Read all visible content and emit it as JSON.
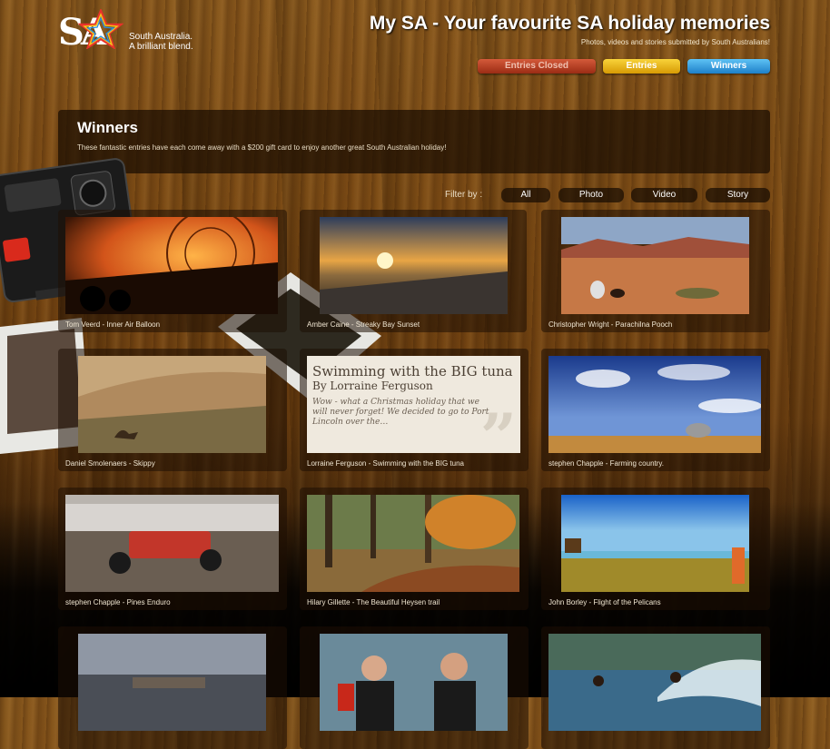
{
  "brand": {
    "logo_letters": "SA",
    "line1": "South Australia.",
    "line2": "A brilliant blend."
  },
  "header": {
    "title": "My SA - Your favourite SA holiday memories",
    "subtitle": "Photos, videos and stories submitted by South Australians!"
  },
  "nav": {
    "entries_closed": "Entries Closed",
    "entries": "Entries",
    "winners": "Winners"
  },
  "winners": {
    "heading": "Winners",
    "description": "These fantastic entries have each come away with a $200 gift card to enjoy another great South Australian holiday!"
  },
  "filter": {
    "label": "Filter by :",
    "options": [
      "All",
      "Photo",
      "Video",
      "Story"
    ]
  },
  "entries": [
    {
      "caption": "Tom Veerd - Inner Air Balloon"
    },
    {
      "caption": "Amber Caine - Streaky Bay Sunset"
    },
    {
      "caption": "Christopher Wright - Parachilna Pooch"
    },
    {
      "caption": "Daniel Smolenaers - Skippy"
    },
    {
      "caption": "Lorraine Ferguson - Swimming with the BIG tuna",
      "story_title": "Swimming with the BIG tuna",
      "story_author": "By Lorraine Ferguson",
      "story_excerpt": "Wow - what a Christmas holiday that we will never forget! We decided to go to Port Lincoln over the…"
    },
    {
      "caption": "stephen Chapple - Farming country."
    },
    {
      "caption": "stephen Chapple - Pines Enduro"
    },
    {
      "caption": "Hilary Gillette - The Beautiful Heysen trail"
    },
    {
      "caption": "John Borley - Flight of the Pelicans"
    },
    {
      "caption": ""
    },
    {
      "caption": ""
    },
    {
      "caption": ""
    }
  ],
  "colors": {
    "entries_closed": "#b8391d",
    "entries": "#f0b80c",
    "winners": "#2f9ae0"
  }
}
